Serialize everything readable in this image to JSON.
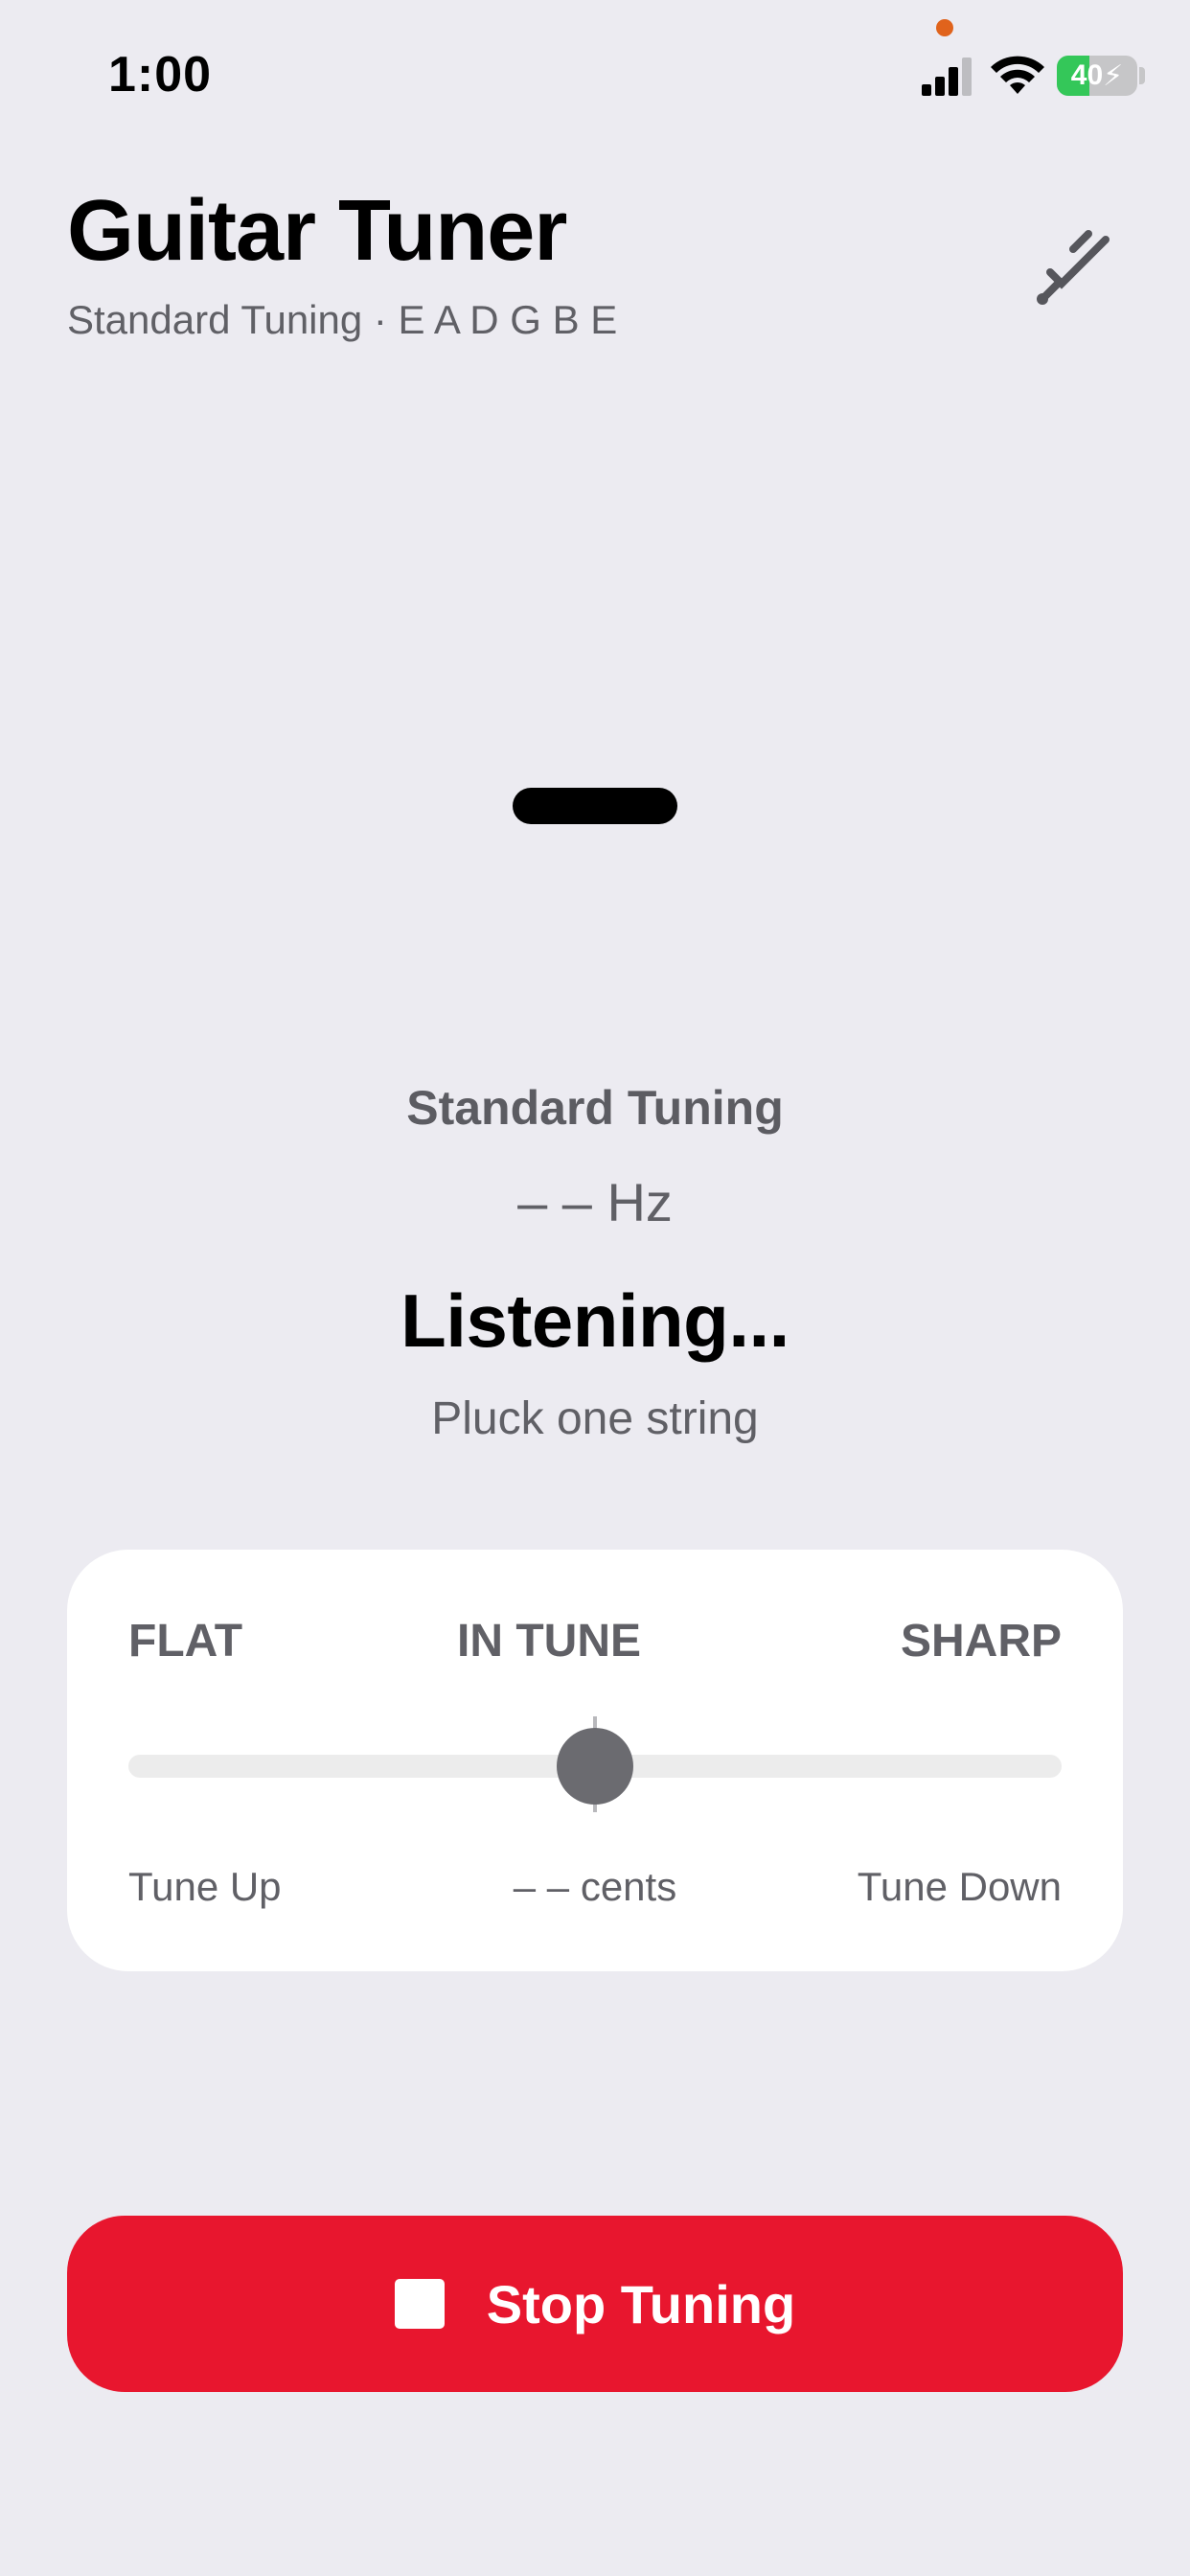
{
  "status_bar": {
    "time": "1:00",
    "battery_level": "40",
    "battery_fraction": 0.4,
    "icons": [
      "signal-icon",
      "wifi-icon",
      "battery-icon",
      "privacy-dot"
    ]
  },
  "header": {
    "title": "Guitar Tuner",
    "subtitle": "Standard Tuning · E A D G B E",
    "tuning_fork_icon": "tuning-fork-icon"
  },
  "tuner": {
    "note_display": "—",
    "tuning_name": "Standard Tuning",
    "frequency": "– – Hz",
    "status": "Listening...",
    "hint": "Pluck one string"
  },
  "meter": {
    "flat_label": "FLAT",
    "in_tune_label": "IN TUNE",
    "sharp_label": "SHARP",
    "tune_up_label": "Tune Up",
    "cents_label": "– – cents",
    "tune_down_label": "Tune Down",
    "needle_position": 0.5
  },
  "actions": {
    "stop_label": "Stop Tuning",
    "stop_icon": "stop-icon"
  },
  "colors": {
    "background": "#ecebf1",
    "accent_red": "#e8162e",
    "battery_green": "#34c759",
    "privacy_dot": "#e0631c",
    "meter_knob": "#6b6b70"
  }
}
